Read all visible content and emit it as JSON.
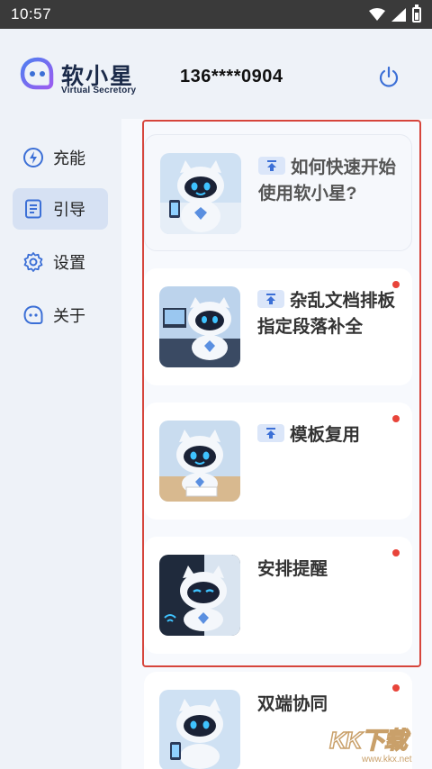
{
  "status_bar": {
    "time": "10:57",
    "icons": [
      "wifi-icon",
      "signal-icon",
      "battery-icon"
    ]
  },
  "header": {
    "brand_name": "软小星",
    "brand_sub": "Virtual Secretory",
    "phone": "136****0904",
    "icons": [
      "logo-icon",
      "power-icon"
    ]
  },
  "sidebar": {
    "items": [
      {
        "label": "充能",
        "icon": "lightning-icon",
        "active": false
      },
      {
        "label": "引导",
        "icon": "document-icon",
        "active": true
      },
      {
        "label": "设置",
        "icon": "gear-icon",
        "active": false
      },
      {
        "label": "关于",
        "icon": "chat-icon",
        "active": false
      }
    ]
  },
  "cards": [
    {
      "title": "如何快速开始使用软小星?",
      "pinned": true,
      "unread": false
    },
    {
      "title": "杂乱文档排板指定段落补全",
      "pinned": true,
      "unread": true
    },
    {
      "title": "模板复用",
      "pinned": true,
      "unread": true
    },
    {
      "title": "安排提醒",
      "pinned": false,
      "unread": true
    },
    {
      "title": "双端协同",
      "pinned": false,
      "unread": true
    }
  ],
  "watermark": {
    "text": "KK下载",
    "url": "www.kkx.net"
  },
  "colors": {
    "accent": "#3b6fd6",
    "highlight_border": "#d6453c",
    "unread_dot": "#e8443a",
    "active_nav": "#d6e1f3"
  }
}
